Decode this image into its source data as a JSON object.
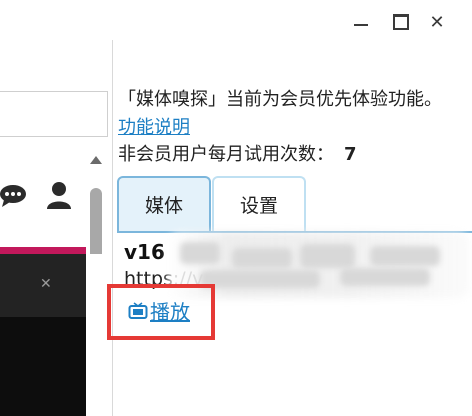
{
  "window": {
    "minimize_icon": "minimize-icon",
    "maximize_icon": "maximize-icon",
    "close_glyph": "✕"
  },
  "panel": {
    "description_prefix": "「媒体嗅探」当前为会员优先体验功能。",
    "feature_link": "功能说明",
    "trial_label": "非会员用户每月试用次数：",
    "trial_count": "7"
  },
  "tabs": [
    {
      "label": "媒体",
      "active": true
    },
    {
      "label": "设置",
      "active": false
    }
  ],
  "media_item": {
    "title_visible": "v16",
    "url_visible": "https://v",
    "play_label": "播放",
    "play_icon": "tv-icon"
  },
  "colors": {
    "accent_link": "#1d7fc4",
    "tab_active_bg": "#e4f2fa",
    "highlight_box": "#e53935"
  }
}
